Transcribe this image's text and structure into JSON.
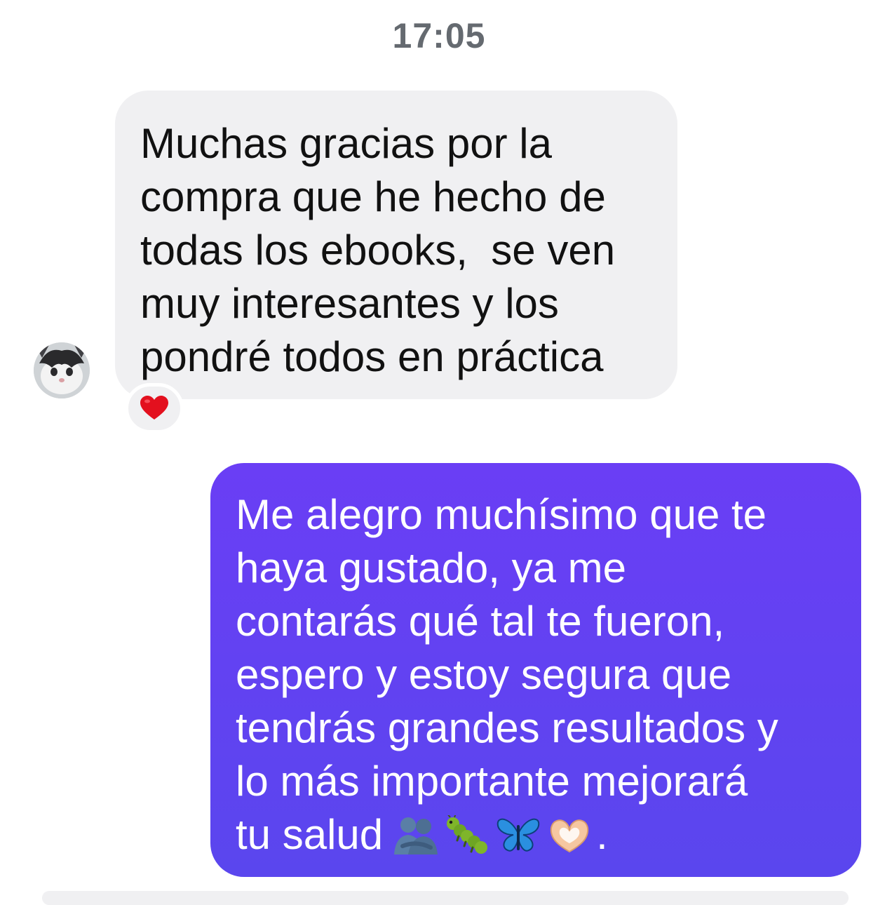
{
  "chat": {
    "timestamp": "17:05",
    "incoming": {
      "text": "Muchas gracias por la\ncompra que he hecho de\ntodas los ebooks,  se ven\nmuy interesantes y los\npondré todos en práctica",
      "reaction": "heart-icon",
      "bubble_color": "#f0f0f2"
    },
    "outgoing": {
      "text": "Me alegro muchísimo que te\nhaya gustado, ya me\ncontarás qué tal te fueron,\nespero y estoy segura que\ntendrás grandes resultados y\nlo más importante mejorará\ntu salud",
      "trailing_emojis": [
        "people-hugging-icon",
        "caterpillar-icon",
        "butterfly-icon",
        "heart-hands-icon"
      ],
      "trailing_punctuation": ".",
      "bubble_color": "#6a3ef5"
    }
  }
}
